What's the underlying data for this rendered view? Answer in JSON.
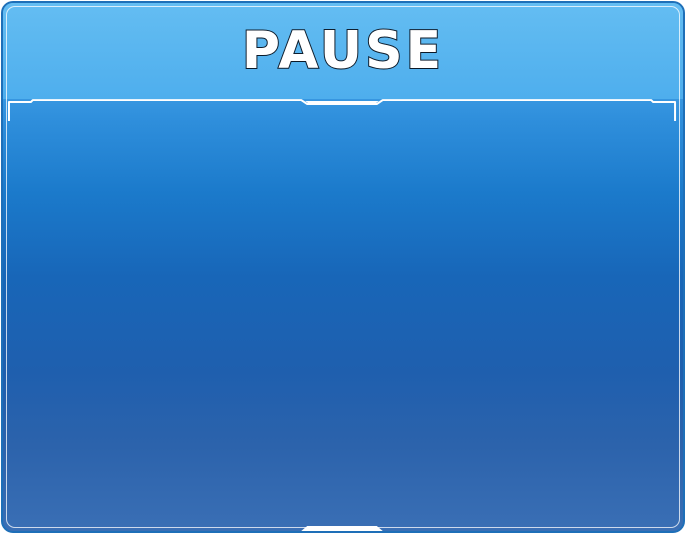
{
  "pause_menu": {
    "title": "PAUSE"
  },
  "colors": {
    "header_top": "#64bdf2",
    "body_mid": "#1866b8",
    "body_bottom": "#3a6fb5",
    "frame_border": "#1e6fb8",
    "frame_highlight": "#ffffff",
    "title_outline": "#0f1e2e"
  }
}
